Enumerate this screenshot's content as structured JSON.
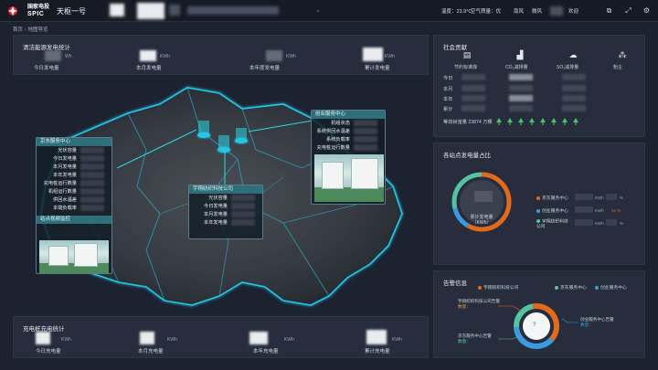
{
  "header": {
    "brand_cn": "国家电投",
    "brand_en": "SPIC",
    "app_title": "天枢一号",
    "temperature": "温度：23.9°C",
    "air_quality": "空气质量：优",
    "wind": "南风",
    "wind_level": "微风",
    "welcome": "欢迎"
  },
  "breadcrumb": {
    "home": "首页",
    "current": "地图导览"
  },
  "clean_energy": {
    "title": "清洁能源发电统计",
    "stats": [
      {
        "label": "今日发电量",
        "unit": "Wh"
      },
      {
        "label": "本月发电量",
        "unit": "KWh"
      },
      {
        "label": "本年度发电量",
        "unit": "KWh"
      },
      {
        "label": "累计发电量",
        "unit": "KWh"
      }
    ]
  },
  "charging": {
    "title": "充电桩充电统计",
    "stats": [
      {
        "label": "今日充电量",
        "unit": "KWh"
      },
      {
        "label": "本月充电量",
        "unit": "KWh"
      },
      {
        "label": "本年充电量",
        "unit": "KWh"
      },
      {
        "label": "累计充电量",
        "unit": "KWh"
      }
    ]
  },
  "map": {
    "popup_jd": {
      "title": "京东服务中心",
      "rows": [
        "光伏容量",
        "今日发电量",
        "本月发电量",
        "本年发电量",
        "充电桩运行数量",
        "机组运行数量",
        "供回水温差",
        "本端负载率"
      ],
      "photo_caption": "站点视频监控"
    },
    "popup_yf": {
      "title": "宇翔纺织科技公司",
      "rows": [
        "光伏容量",
        "今日发电量",
        "本月发电量",
        "本年发电量"
      ]
    },
    "popup_cy": {
      "title": "创业服务中心",
      "rows": [
        "机组状态",
        "系统供回水温差",
        "系统负载率",
        "充电桩运行数量"
      ]
    }
  },
  "social": {
    "title": "社会贡献",
    "categories": [
      {
        "label": "节约标准煤",
        "icon": "coal-icon"
      },
      {
        "label": "CO₂减排量",
        "icon": "co2-icon"
      },
      {
        "label": "SO₂减排量",
        "icon": "so2-icon"
      },
      {
        "label": "粉尘",
        "icon": "dust-icon"
      }
    ],
    "rows": [
      "今日",
      "本月",
      "本年",
      "累计"
    ],
    "trees_label": "等效树苗量 23874 万棵"
  },
  "station_share": {
    "title": "各站点发电量占比",
    "center_label": "累计发电量\n（KWh）",
    "legend": [
      {
        "name": "京东服务中心",
        "color": "#e26a1c",
        "unit": "KWh",
        "pct": "%"
      },
      {
        "name": "创业服务中心",
        "color": "#3a9be0",
        "unit": "KWh",
        "pct": "12 %"
      },
      {
        "name": "宇翔纺织科技公司",
        "color": "#53c3a2",
        "unit": "KWh",
        "pct": "%"
      }
    ]
  },
  "alarm": {
    "title": "告警信息",
    "legend": [
      {
        "name": "宇翔纺织科技公司",
        "color": "#e26a1c"
      },
      {
        "name": "京东服务中心",
        "color": "#53c3a2"
      },
      {
        "name": "创业服务中心",
        "color": "#3a9be0"
      }
    ],
    "notes": [
      {
        "title": "宇翔纺织科技公司告警",
        "sub": "数量："
      },
      {
        "title": "京东服务中心告警",
        "sub": "数量："
      },
      {
        "title": "创业服务中心告警",
        "sub": "数量："
      }
    ],
    "center": "?"
  },
  "colors": {
    "accent_orange": "#e26a1c",
    "accent_blue": "#3a9be0",
    "accent_teal": "#53c3a2",
    "map_glow": "#23c7e8"
  }
}
